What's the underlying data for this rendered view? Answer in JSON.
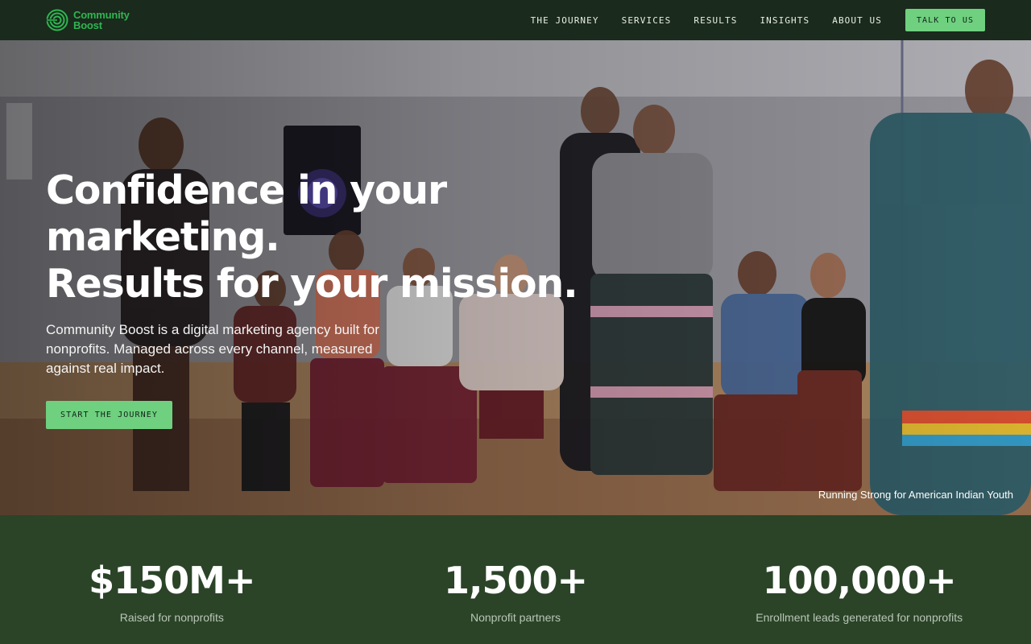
{
  "brand": {
    "name_line1": "Community",
    "name_line2": "Boost",
    "logo_icon": "concentric-circles-icon",
    "accent_color": "#2fb551"
  },
  "nav": {
    "items": [
      {
        "label": "THE JOURNEY"
      },
      {
        "label": "SERVICES"
      },
      {
        "label": "RESULTS"
      },
      {
        "label": "INSIGHTS"
      },
      {
        "label": "ABOUT US"
      }
    ],
    "cta_label": "TALK TO US",
    "cta_color": "#6fd07f"
  },
  "hero": {
    "title_line1": "Confidence in your marketing.",
    "title_line2": "Results for your mission.",
    "subtitle": "Community Boost is a digital marketing agency built for nonprofits. Managed across every channel, measured against real impact.",
    "cta_label": "START THE JOURNEY",
    "photo_caption": "Running Strong for American Indian Youth"
  },
  "stats": [
    {
      "value": "$150M+",
      "label": "Raised for nonprofits"
    },
    {
      "value": "1,500+",
      "label": "Nonprofit partners"
    },
    {
      "value": "100,000+",
      "label": "Enrollment leads generated for nonprofits"
    }
  ],
  "colors": {
    "nav_bg": "#1a2a1c",
    "stats_bg": "#2b4428"
  }
}
